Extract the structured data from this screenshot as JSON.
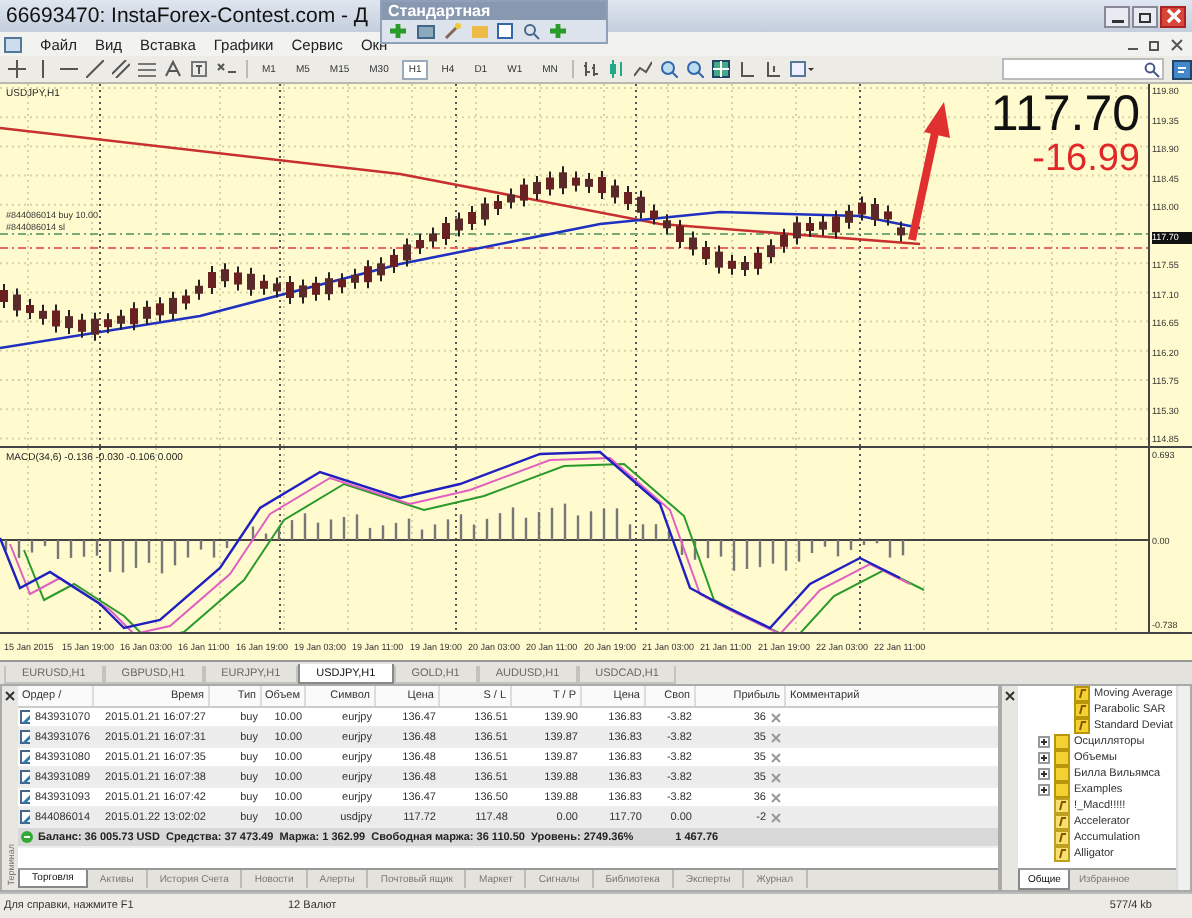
{
  "window": {
    "title": "66693470: InstaForex-Contest.com - Д"
  },
  "floating_toolbar": {
    "title": "Стандартная"
  },
  "menu": [
    {
      "label": "Файл"
    },
    {
      "label": "Вид"
    },
    {
      "label": "Вставка"
    },
    {
      "label": "Графики"
    },
    {
      "label": "Сервис"
    },
    {
      "label": "Окн"
    }
  ],
  "timeframes": [
    {
      "label": "M1",
      "selected": false
    },
    {
      "label": "M5",
      "selected": false
    },
    {
      "label": "M15",
      "selected": false
    },
    {
      "label": "M30",
      "selected": false
    },
    {
      "label": "H1",
      "selected": true
    },
    {
      "label": "H4",
      "selected": false
    },
    {
      "label": "D1",
      "selected": false
    },
    {
      "label": "W1",
      "selected": false
    },
    {
      "label": "MN",
      "selected": false
    }
  ],
  "chart": {
    "symbol": "USDJPY,H1",
    "order_labels": [
      "#844086014 buy 10.00",
      "#844086014 sl"
    ],
    "price_axis": [
      {
        "label": "119.80",
        "kind": "tick"
      },
      {
        "label": "119.35",
        "kind": "tick"
      },
      {
        "label": "118.90",
        "kind": "tick"
      },
      {
        "label": "118.45",
        "kind": "tick"
      },
      {
        "label": "118.00",
        "kind": "tick"
      },
      {
        "label": "117.70",
        "kind": "current"
      },
      {
        "label": "117.55",
        "kind": "tick"
      },
      {
        "label": "117.10",
        "kind": "tick"
      },
      {
        "label": "116.65",
        "kind": "tick"
      },
      {
        "label": "116.20",
        "kind": "tick"
      },
      {
        "label": "115.75",
        "kind": "tick"
      },
      {
        "label": "115.30",
        "kind": "tick"
      },
      {
        "label": "114.85",
        "kind": "tick"
      }
    ],
    "overlay": {
      "price": "117.70",
      "change": "-16.99"
    },
    "indicator": {
      "label": "MACD(34,6) -0.136 -0.030 -0.106 0.000",
      "axis": [
        "0.693",
        "0.00",
        "-0.738"
      ]
    },
    "time_axis": [
      "15 Jan 2015",
      "15 Jan 19:00",
      "16 Jan 03:00",
      "16 Jan 11:00",
      "16 Jan 19:00",
      "19 Jan 03:00",
      "19 Jan 11:00",
      "19 Jan 19:00",
      "20 Jan 03:00",
      "20 Jan 11:00",
      "20 Jan 19:00",
      "21 Jan 03:00",
      "21 Jan 11:00",
      "21 Jan 19:00",
      "22 Jan 03:00",
      "22 Jan 11:00"
    ]
  },
  "chart_tabs": [
    {
      "label": "EURUSD,H1",
      "selected": false
    },
    {
      "label": "GBPUSD,H1",
      "selected": false
    },
    {
      "label": "EURJPY,H1",
      "selected": false
    },
    {
      "label": "USDJPY,H1",
      "selected": true
    },
    {
      "label": "GOLD,H1",
      "selected": false
    },
    {
      "label": "AUDUSD,H1",
      "selected": false
    },
    {
      "label": "USDCAD,H1",
      "selected": false
    }
  ],
  "terminal": {
    "side_label": "Терминал",
    "columns": [
      "Ордер /",
      "Время",
      "Тип",
      "Объем",
      "Символ",
      "Цена",
      "S / L",
      "T / P",
      "Цена",
      "Своп",
      "Прибыль",
      "Комментарий"
    ],
    "rows": [
      {
        "cells": [
          "843931070",
          "2015.01.21 16:07:27",
          "buy",
          "10.00",
          "eurjpy",
          "136.47",
          "136.51",
          "139.90",
          "136.83",
          "-3.82",
          "36"
        ]
      },
      {
        "cells": [
          "843931076",
          "2015.01.21 16:07:31",
          "buy",
          "10.00",
          "eurjpy",
          "136.48",
          "136.51",
          "139.87",
          "136.83",
          "-3.82",
          "35"
        ]
      },
      {
        "cells": [
          "843931080",
          "2015.01.21 16:07:35",
          "buy",
          "10.00",
          "eurjpy",
          "136.48",
          "136.51",
          "139.87",
          "136.83",
          "-3.82",
          "35"
        ]
      },
      {
        "cells": [
          "843931089",
          "2015.01.21 16:07:38",
          "buy",
          "10.00",
          "eurjpy",
          "136.48",
          "136.51",
          "139.88",
          "136.83",
          "-3.82",
          "35"
        ]
      },
      {
        "cells": [
          "843931093",
          "2015.01.21 16:07:42",
          "buy",
          "10.00",
          "eurjpy",
          "136.47",
          "136.50",
          "139.88",
          "136.83",
          "-3.82",
          "36"
        ]
      },
      {
        "cells": [
          "844086014",
          "2015.01.22 13:02:02",
          "buy",
          "10.00",
          "usdjpy",
          "117.72",
          "117.48",
          "0.00",
          "117.70",
          "0.00",
          "-2"
        ]
      }
    ],
    "summary": {
      "text": "Баланс: 36 005.73 USD  Средства: 37 473.49  Маржа: 1 362.99  Свободная маржа: 36 110.50  Уровень: 2749.36%",
      "profit": "1 467.76"
    },
    "tabs": [
      {
        "label": "Торговля",
        "selected": true
      },
      {
        "label": "Активы",
        "selected": false
      },
      {
        "label": "История Счета",
        "selected": false
      },
      {
        "label": "Новости",
        "selected": false
      },
      {
        "label": "Алерты",
        "selected": false
      },
      {
        "label": "Почтовый ящик",
        "selected": false
      },
      {
        "label": "Маркет",
        "selected": false
      },
      {
        "label": "Сигналы",
        "selected": false
      },
      {
        "label": "Библиотека",
        "selected": false
      },
      {
        "label": "Эксперты",
        "selected": false
      },
      {
        "label": "Журнал",
        "selected": false
      }
    ]
  },
  "navigator": {
    "tree": [
      {
        "kind": "group",
        "children": [
          {
            "kind": "indicator",
            "label": "Moving Average"
          },
          {
            "kind": "indicator",
            "label": "Parabolic SAR"
          },
          {
            "kind": "indicator",
            "label": "Standard Deviat"
          }
        ]
      },
      {
        "kind": "folder",
        "label": "Осцилляторы",
        "expanded": false
      },
      {
        "kind": "folder",
        "label": "Объемы",
        "expanded": false
      },
      {
        "kind": "folder",
        "label": "Билла Вильямса",
        "expanded": false
      },
      {
        "kind": "folder",
        "label": "Examples",
        "expanded": false
      },
      {
        "kind": "script",
        "label": "!_Macd!!!!!"
      },
      {
        "kind": "script",
        "label": "Accelerator"
      },
      {
        "kind": "script",
        "label": "Accumulation"
      },
      {
        "kind": "script",
        "label": "Alligator"
      }
    ],
    "tabs": [
      {
        "label": "Общие",
        "selected": true
      },
      {
        "label": "Избранное",
        "selected": false
      }
    ]
  },
  "status_bar": [
    "Для справки, нажмите F1",
    "12 Валют",
    "577/4 kb"
  ]
}
